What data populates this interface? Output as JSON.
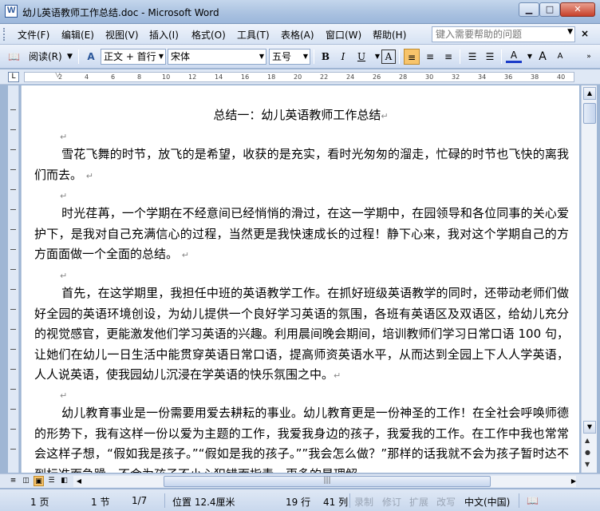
{
  "window": {
    "title": "幼儿英语教师工作总结.doc - Microsoft Word",
    "min_label": "▁",
    "max_label": "□",
    "close_label": "✕"
  },
  "menu": {
    "items": [
      "文件(F)",
      "编辑(E)",
      "视图(V)",
      "插入(I)",
      "格式(O)",
      "工具(T)",
      "表格(A)",
      "窗口(W)",
      "帮助(H)"
    ],
    "help_placeholder": "键入需要帮助的问题",
    "close_doc": "×"
  },
  "toolbar": {
    "reading_label": "阅读(R)",
    "style_value": "正文 + 首行",
    "font_value": "宋体",
    "size_value": "五号",
    "bold": "B",
    "italic": "I",
    "underline": "U",
    "char_border": "A",
    "grow_font": "A",
    "shrink_font": "A"
  },
  "ruler": {
    "corner": "L",
    "ticks": [
      "2",
      "4",
      "6",
      "8",
      "10",
      "12",
      "14",
      "16",
      "18",
      "20",
      "22",
      "24",
      "26",
      "28",
      "30",
      "32",
      "34",
      "36",
      "38",
      "40"
    ]
  },
  "document": {
    "title": "总结一：幼儿英语教师工作总结",
    "paragraphs": [
      "雪花飞舞的时节，放飞的是希望，收获的是充实，看时光匆匆的溜走，忙碌的时节也飞快的离我们而去。",
      "时光荏苒，一个学期在不经意间已经悄悄的滑过，在这一学期中，在园领导和各位同事的关心爱护下，是我对自己充满信心的过程，当然更是我快速成长的过程！静下心来，我对这个学期自己的方方面面做一个全面的总结。",
      "首先，在这学期里，我担任中班的英语教学工作。在抓好班级英语教学的同时，还带动老师们做好全园的英语环境创设，为幼儿提供一个良好学习英语的氛围，各班有英语区及双语区，给幼儿充分的视觉感官，更能激发他们学习英语的兴趣。利用晨间晚会期间，培训教师们学习日常口语 100 句，让她们在幼儿一日生活中能贯穿英语日常口语，提高师资英语水平，从而达到全园上下人人学英语，人人说英语，使我园幼儿沉浸在学英语的快乐氛围之中。",
      "幼儿教育事业是一份需要用爱去耕耘的事业。幼儿教育更是一份神圣的工作！在全社会呼唤师德的形势下，我有这样一份以爱为主题的工作，我爱我身边的孩子，我爱我的工作。在工作中我也常常会这样子想，“假如我是孩子。”“假如是我的孩子。””我会怎么做？”那样的话我就不会为孩子暂时达不到标准而急躁，不会为孩子不小心犯错而指责，更多的是理解"
    ]
  },
  "status": {
    "page": "1 页",
    "section": "1 节",
    "page_of": "1/7",
    "position": "位置 12.4厘米",
    "line": "19 行",
    "column": "41 列",
    "rec": "录制",
    "trk": "修订",
    "ext": "扩展",
    "ovr": "改写",
    "language": "中文(中国)"
  }
}
